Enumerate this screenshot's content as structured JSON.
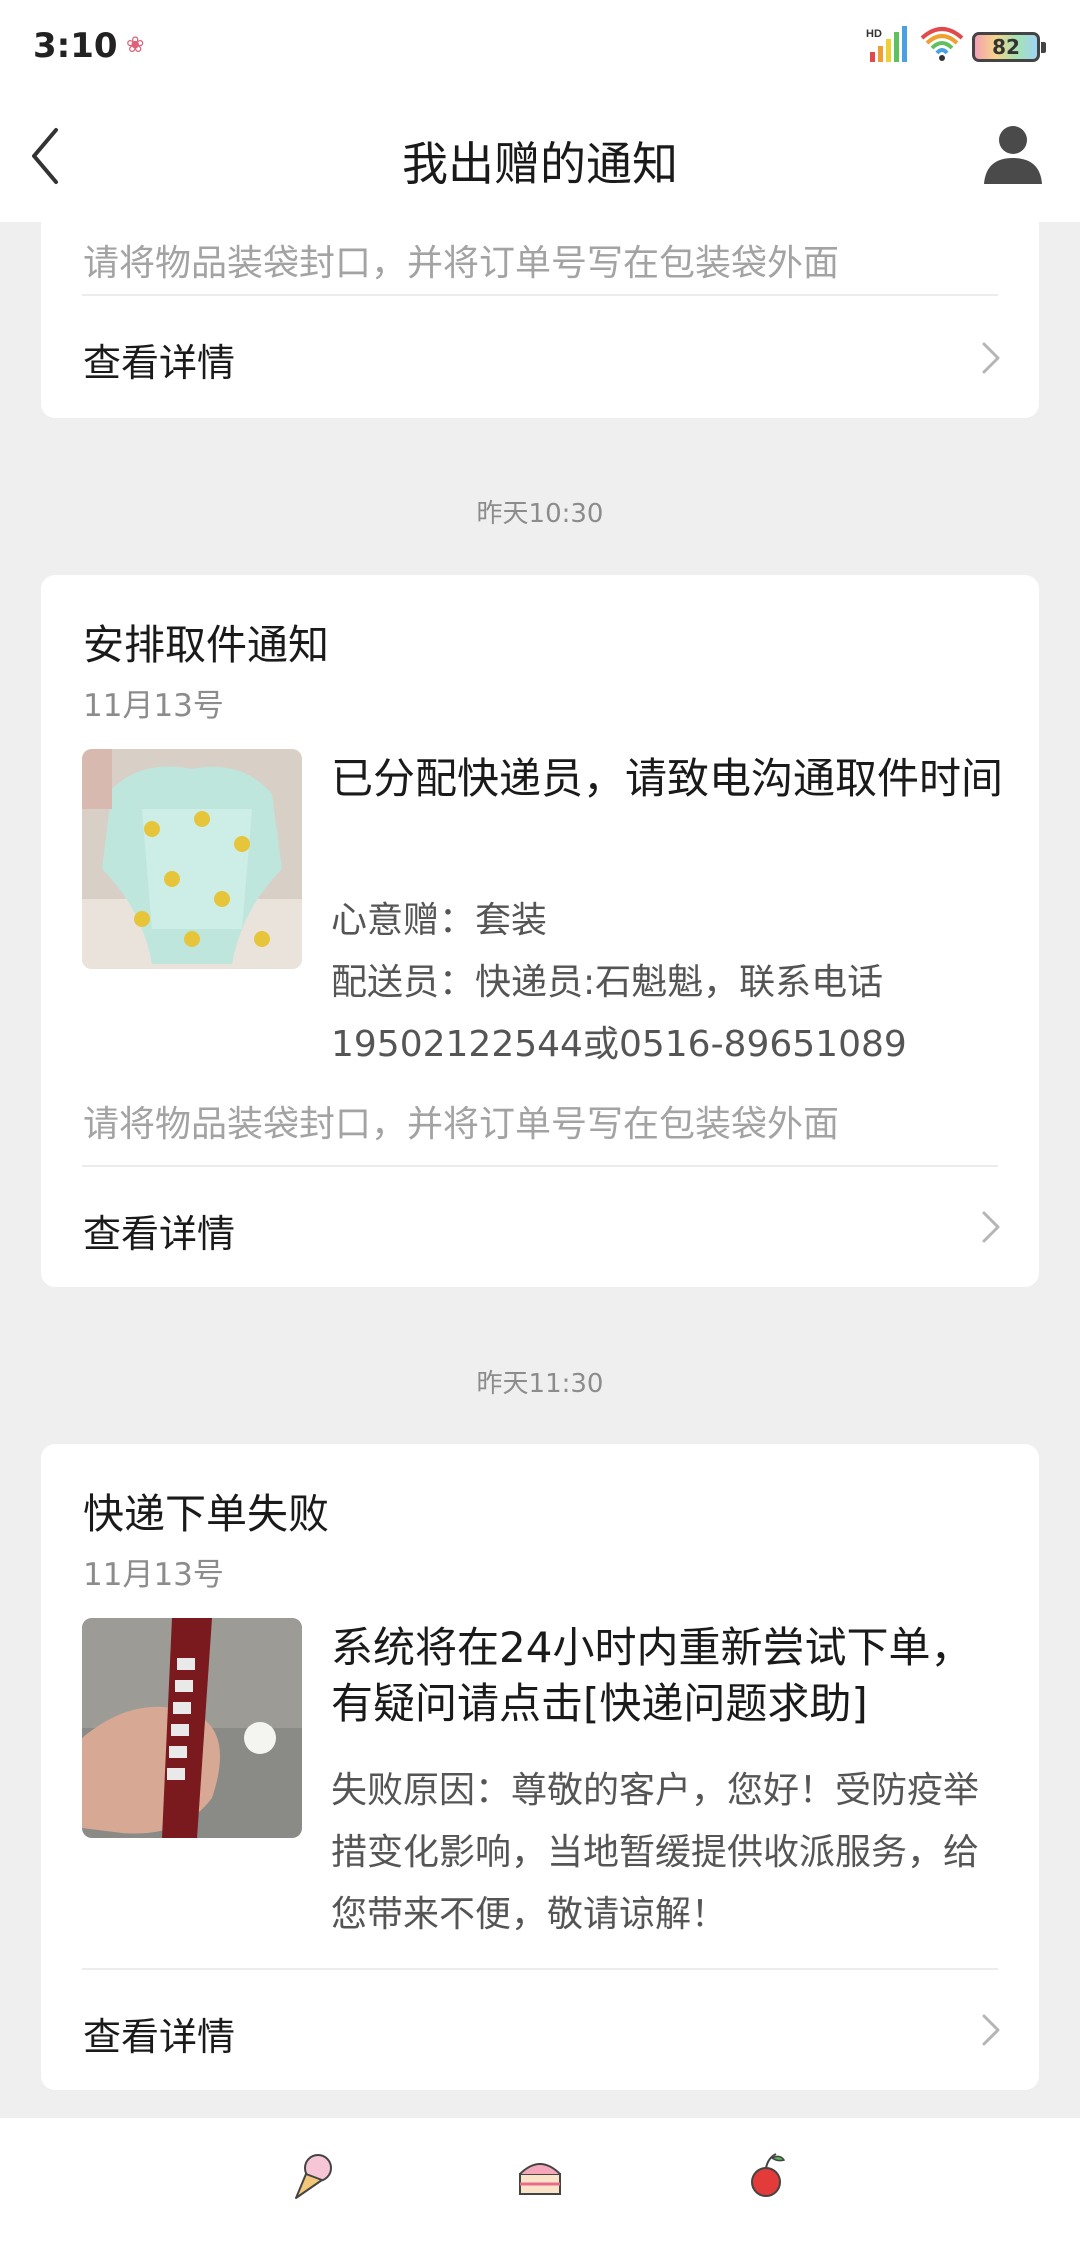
{
  "status_bar": {
    "time": "3:10",
    "battery": "82",
    "network": "HD",
    "icons": [
      "flower-icon",
      "signal-icon",
      "wifi-icon",
      "battery-icon"
    ]
  },
  "nav": {
    "title": "我出赠的通知",
    "icons": [
      "back-arrow-icon",
      "profile-icon"
    ]
  },
  "cards": [
    {
      "note": "请将物品装袋封口，并将订单号写在包装袋外面",
      "detail_label": "查看详情"
    },
    {
      "timestamp": "昨天10:30",
      "title": "安排取件通知",
      "date": "11月13号",
      "message_title": "已分配快递员，请致电沟通取件时间",
      "lines": [
        "心意赠：套装",
        "配送员：快递员:石魁魁，联系电话19502122544或0516-89651089"
      ],
      "note": "请将物品装袋封口，并将订单号写在包装袋外面",
      "detail_label": "查看详情"
    },
    {
      "timestamp": "昨天11:30",
      "title": "快递下单失败",
      "date": "11月13号",
      "message_title": "系统将在24小时内重新尝试下单，有疑问请点击[快递问题求助]",
      "lines": [
        "失败原因：尊敬的客户，您好！受防疫举措变化影响，当地暂缓提供收派服务，给您带来不便，敬请谅解！"
      ],
      "detail_label": "查看详情"
    }
  ],
  "bottom_bar": {
    "icons": [
      "ice-cream-icon",
      "cake-icon",
      "cherry-icon"
    ]
  },
  "colors": {
    "background": "#efefef",
    "card": "#ffffff",
    "muted_text": "#8c8c8c",
    "note_text": "#a3a3a3"
  }
}
